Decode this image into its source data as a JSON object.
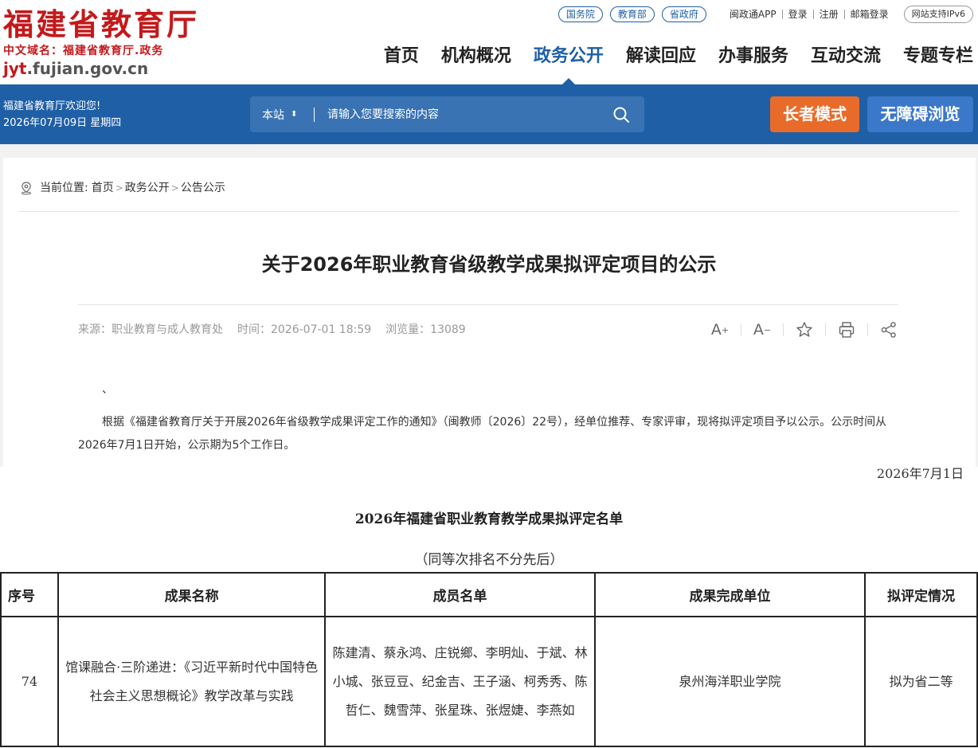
{
  "header": {
    "logo_title": "福建省教育厅",
    "logo_domain": "中文域名：福建省教育厅.政务",
    "logo_url_prefix": "jyt",
    "logo_url_suffix": ".fujian.gov.cn",
    "toplinks": {
      "pills": [
        "国务院",
        "教育部",
        "省政府"
      ],
      "links": [
        "闽政通APP",
        "登录",
        "注册",
        "邮箱登录"
      ],
      "ipv6": "网站支持IPv6"
    },
    "nav": [
      "首页",
      "机构概况",
      "政务公开",
      "解读回应",
      "办事服务",
      "互动交流",
      "专题专栏"
    ],
    "nav_active": "政务公开"
  },
  "bluebar": {
    "welcome": "福建省教育厅欢迎您!",
    "date": "2026年07月09日 星期四",
    "search_scope": "本站",
    "search_placeholder": "请输入您要搜索的内容",
    "elder_mode": "长者模式",
    "accessible": "无障碍浏览"
  },
  "breadcrumb": {
    "prefix": "当前位置:",
    "items": [
      "首页",
      "政务公开",
      "公告公示"
    ]
  },
  "article": {
    "title": "关于2026年职业教育省级教学成果拟评定项目的公示",
    "source": "来源：职业教育与成人教育处",
    "time": "时间：2026-07-01 18:59",
    "views": "浏览量：13089",
    "mark": "、",
    "body": "根据《福建省教育厅关于开展2026年省级教学成果评定工作的通知》（闽教师〔2026〕22号），经单位推荐、专家评审，现将拟评定项目予以公示。公示时间从2026年7月1日开始，公示期为5个工作日。",
    "date": "2026年7月1日",
    "list_title": "2026年福建省职业教育教学成果拟评定名单",
    "list_subtitle": "（同等次排名不分先后）"
  },
  "table": {
    "headers": [
      "序号",
      "成果名称",
      "成员名单",
      "成果完成单位",
      "拟评定情况"
    ],
    "rows": [
      {
        "idx": "74",
        "name": "馆课融合·三阶递进：《习近平新时代中国特色社会主义思想概论》教学改革与实践",
        "members": "陈建清、蔡永鸿、庄锐鄉、李明灿、于斌、林小城、张豆豆、纪金吉、王子涵、柯秀秀、陈哲仁、魏雪萍、张星珠、张煜婕、李燕如",
        "unit": "泉州海洋职业学院",
        "status": "拟为省二等"
      }
    ]
  },
  "colors": {
    "brand_red": "#c4191b",
    "brand_blue": "#1f5fa6",
    "elder_orange": "#e96b2a"
  }
}
